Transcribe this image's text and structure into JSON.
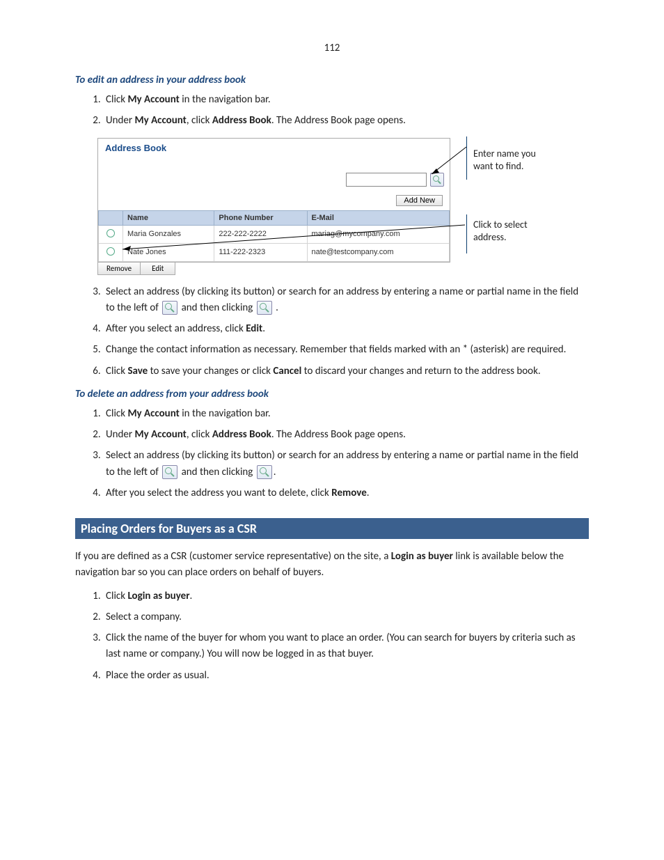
{
  "page_number": "112",
  "edit_section": {
    "heading": "To edit an address in your address book",
    "steps": {
      "s1_a": "Click ",
      "s1_b": "My Account",
      "s1_c": " in the navigation bar.",
      "s2_a": "Under ",
      "s2_b": "My Account",
      "s2_c": ", click ",
      "s2_d": "Address Book",
      "s2_e": ". The Address Book page opens.",
      "s3_a": "Select an address (by clicking its button) or search for an address by entering a name or partial name in the field to the left of ",
      "s3_b": " and then clicking ",
      "s3_c": " .",
      "s4_a": "After you select an address, click ",
      "s4_b": "Edit",
      "s4_c": ".",
      "s5": "Change the contact information as necessary. Remember that fields marked with an * (asterisk) are required.",
      "s6_a": "Click ",
      "s6_b": "Save",
      "s6_c": " to save your changes or click ",
      "s6_d": "Cancel",
      "s6_e": " to discard your changes and return to the address book."
    }
  },
  "figure": {
    "title": "Address Book",
    "add_new_label": "Add New",
    "columns": {
      "c1": "Name",
      "c2": "Phone Number",
      "c3": "E-Mail"
    },
    "rows": [
      {
        "name": "Maria Gonzales",
        "phone": "222-222-2222",
        "email": "mariag@mycompany.com"
      },
      {
        "name": "Nate Jones",
        "phone": "111-222-2323",
        "email": "nate@testcompany.com"
      }
    ],
    "remove_label": "Remove",
    "edit_label": "Edit",
    "callout1": "Enter name you want to find.",
    "callout2": "Click to select address."
  },
  "delete_section": {
    "heading": "To delete an address from your address book",
    "steps": {
      "s1_a": "Click ",
      "s1_b": "My Account",
      "s1_c": " in the navigation bar.",
      "s2_a": "Under ",
      "s2_b": "My Account",
      "s2_c": ", click ",
      "s2_d": "Address Book",
      "s2_e": ". The Address Book page opens.",
      "s3_a": "Select an address (by clicking its button) or search for an address by entering a name or partial name in the field to the left of ",
      "s3_b": " and then clicking ",
      "s3_c": ".",
      "s4_a": "After you select the address you want to delete, click ",
      "s4_b": "Remove",
      "s4_c": "."
    }
  },
  "csr_section": {
    "heading": "Placing Orders for Buyers as a CSR",
    "intro_a": "If you are defined as a CSR (customer service representative) on the site, a ",
    "intro_b": "Login as buyer",
    "intro_c": " link is available below the navigation bar so you can place orders on behalf of buyers.",
    "steps": {
      "s1_a": "Click ",
      "s1_b": "Login as buyer",
      "s1_c": ".",
      "s2": "Select a company.",
      "s3": "Click the name of the buyer for whom you want to place an order. (You can search for buyers by criteria such as last name or company.) You will now be logged in as that buyer.",
      "s4": "Place the order as usual."
    }
  }
}
